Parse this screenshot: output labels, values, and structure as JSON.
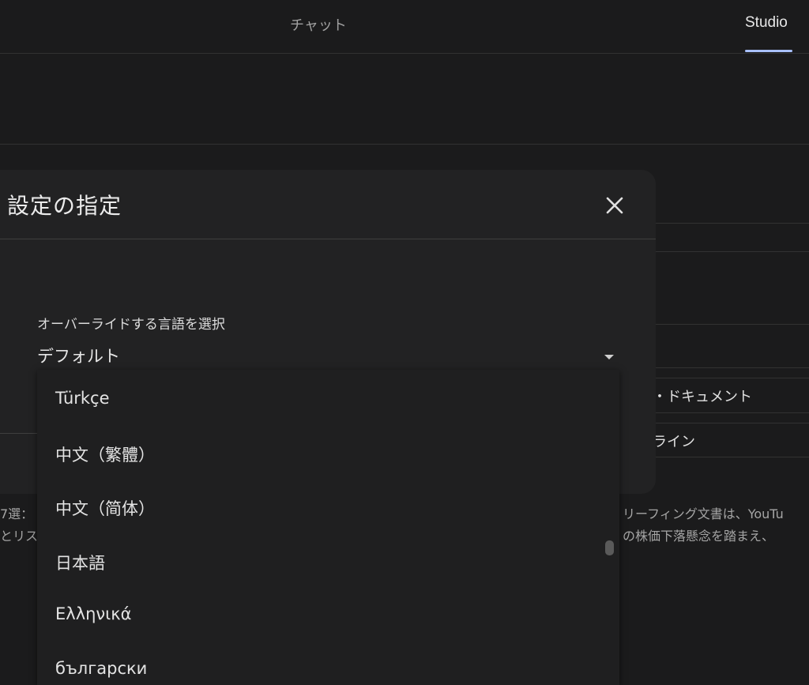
{
  "tabs": {
    "chat": "チャット",
    "studio": "Studio"
  },
  "background": {
    "row_document": "・ドキュメント",
    "row_timeline": "ライン",
    "text_left_1": "7選：",
    "text_left_2": "とリス",
    "text_right_1": "リーフィング文書は、YouTu",
    "text_right_2": "の株価下落懸念を踏まえ、"
  },
  "dialog": {
    "title": "設定の指定",
    "select_label": "オーバーライドする言語を選択",
    "select_value": "デフォルト",
    "options": [
      "Türkçe",
      "中文（繁體）",
      "中文（简体）",
      "日本語",
      "Ελληνικά",
      "български"
    ]
  }
}
